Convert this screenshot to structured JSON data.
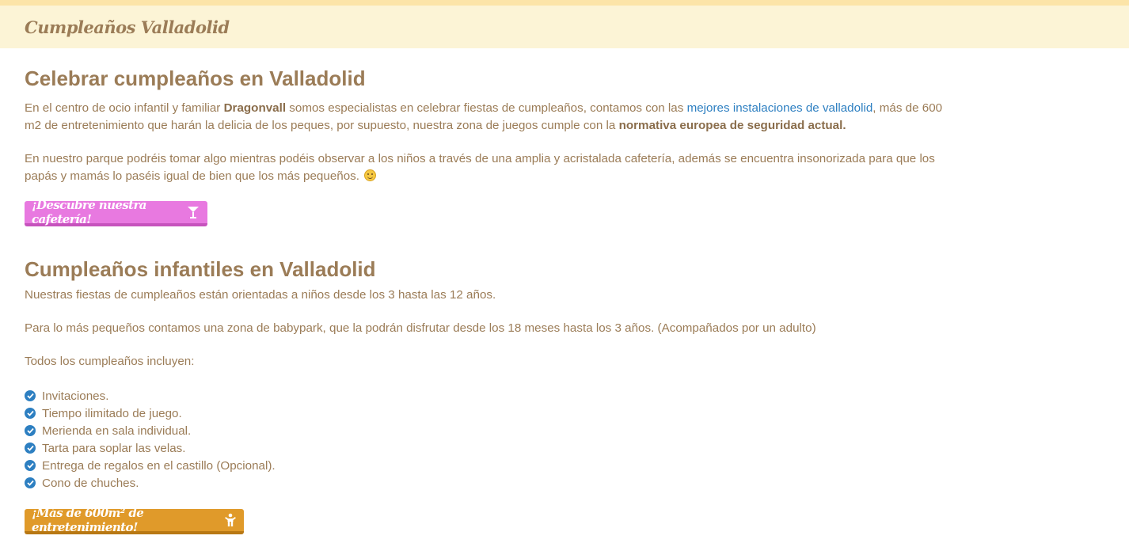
{
  "header": {
    "site_title": "Cumpleaños Valladolid"
  },
  "section1": {
    "title": "Celebrar cumpleaños en Valladolid",
    "p1": {
      "t1": "En el centro de ocio infantil y familiar ",
      "b1": "Dragonvall",
      "t2": " somos especialistas en celebrar fiestas de cumpleaños, contamos con las ",
      "link": "mejores instalaciones de valladolid",
      "t3": ", más de 600 m2 de entretenimiento que harán la delicia de los peques, por supuesto, nuestra zona de juegos cumple con la ",
      "b2": "normativa europea de seguridad actual."
    },
    "p2": "En nuestro parque podréis tomar algo mientras podéis observar a los niños a través de una amplia y acristalada cafetería, además se encuentra insonorizada para que los papás y mamás lo paséis igual de bien que los más pequeños.",
    "button_label": "¡Descubre nuestra cafetería!",
    "button_icon": "cocktail-glass-icon",
    "button_color": "#e879e0"
  },
  "section2": {
    "title": "Cumpleaños infantiles en Valladolid",
    "p1": "Nuestras fiestas de cumpleaños están orientadas a niños desde los 3 hasta las 12 años.",
    "p2": "Para lo más pequeños contamos una zona de babypark, que la podrán disfrutar desde los 18 meses hasta los 3 años. (Acompañados por un adulto)",
    "p3": "Todos los cumpleaños incluyen:",
    "features": [
      "Invitaciones.",
      "Tiempo ilimitado de juego.",
      "Merienda en sala individual.",
      "Tarta para soplar las velas.",
      "Entrega de regalos en el castillo (Opcional).",
      "Cono de chuches."
    ],
    "button_label": "¡Más de 600m² de entretenimiento!",
    "button_icon": "child-icon",
    "button_color": "#e09a2a"
  },
  "colors": {
    "text": "#9b7c57",
    "link": "#2d7fc1",
    "header_bg": "#fcf4d6",
    "check": "#2d7fc1"
  }
}
